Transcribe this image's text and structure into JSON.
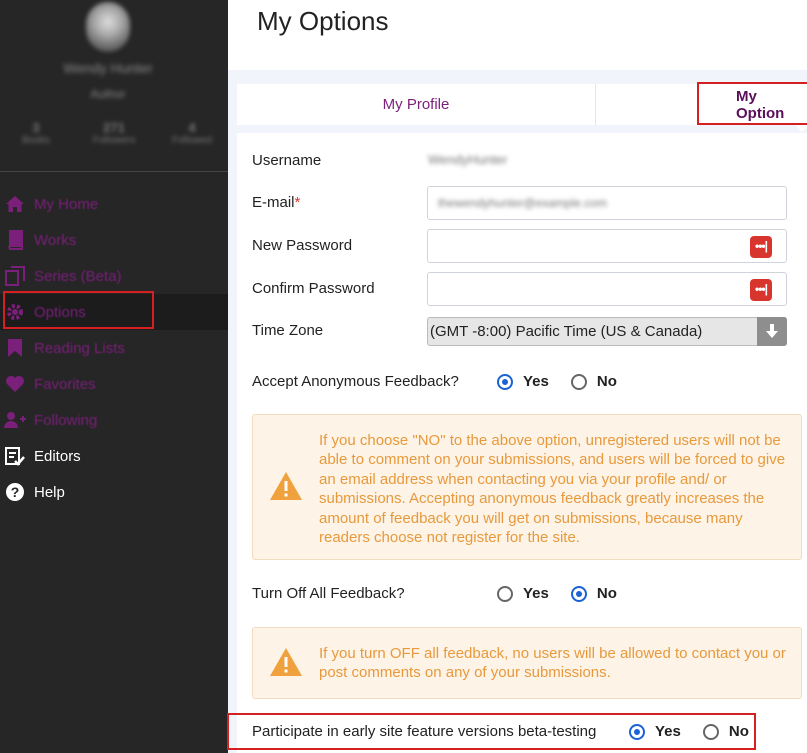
{
  "sidebar": {
    "user_name": "Wendy Hunter",
    "user_role": "Author",
    "stats": [
      {
        "num": "3",
        "label": "Books"
      },
      {
        "num": "271",
        "label": "Followers"
      },
      {
        "num": "4",
        "label": "Followed"
      }
    ],
    "nav": [
      {
        "label": "My Home",
        "icon": "home-icon"
      },
      {
        "label": "Works",
        "icon": "book-icon"
      },
      {
        "label": "Series (Beta)",
        "icon": "series-icon"
      },
      {
        "label": "Options",
        "icon": "gear-icon"
      },
      {
        "label": "Reading Lists",
        "icon": "bookmark-icon"
      },
      {
        "label": "Favorites",
        "icon": "heart-icon"
      },
      {
        "label": "Following",
        "icon": "user-plus-icon"
      },
      {
        "label": "Editors",
        "icon": "editor-check-icon"
      },
      {
        "label": "Help",
        "icon": "help-icon"
      }
    ]
  },
  "page": {
    "title": "My Options"
  },
  "tabs": {
    "profile": "My Profile",
    "options": "My Option"
  },
  "form": {
    "username_label": "Username",
    "username_value": "WendyHunter",
    "email_label": "E-mail",
    "email_required_mark": "*",
    "email_value": "thewendyhunter@example.com",
    "new_password_label": "New Password",
    "confirm_password_label": "Confirm Password",
    "password_icon_text": "•••|",
    "timezone_label": "Time Zone",
    "timezone_value": "(GMT -8:00) Pacific Time (US & Canada)",
    "anon_label": "Accept Anonymous Feedback?",
    "anon_yes": "Yes",
    "anon_no": "No",
    "anon_warning": "If you choose \"NO\" to the above option, unregistered users will not be able to comment on your submissions, and users will be forced to give an email address when contacting you via your profile and/ or submissions. Accepting anonymous feedback greatly increases the amount of feedback you will get on submissions, because many readers choose not register for the site.",
    "off_label": "Turn Off All Feedback?",
    "off_yes": "Yes",
    "off_no": "No",
    "off_warning": "If you turn OFF all feedback, no users will be allowed to contact you or post comments on any of your submissions.",
    "beta_label": "Participate in early site feature versions beta-testing",
    "beta_yes": "Yes",
    "beta_no": "No"
  },
  "colors": {
    "accent_purple": "#7a1f7a",
    "highlight_red": "#d42020",
    "radio_blue": "#1a62d6",
    "warning_orange": "#e79a3d"
  }
}
